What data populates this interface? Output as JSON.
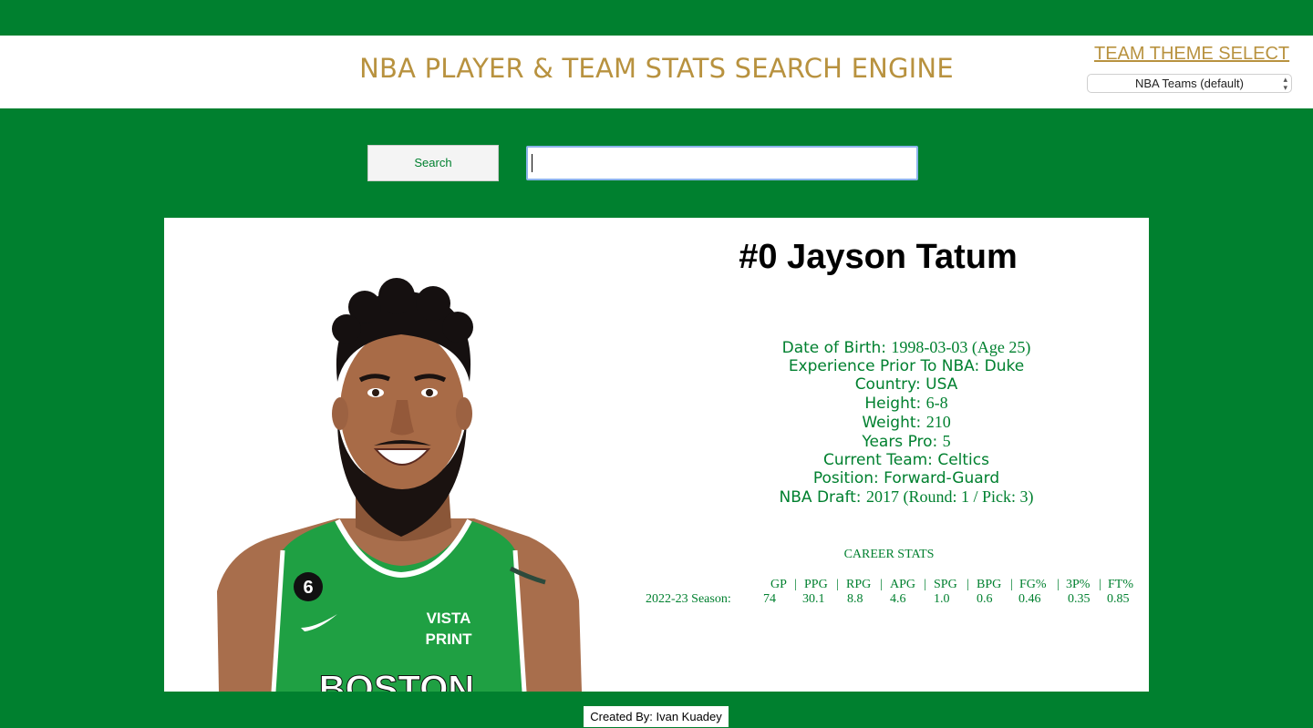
{
  "header": {
    "title": "NBA PLAYER & TEAM STATS SEARCH ENGINE",
    "theme_link": "TEAM THEME SELECT",
    "theme_selected": "NBA Teams (default)"
  },
  "search": {
    "button_label": "Search",
    "value": ""
  },
  "player": {
    "name": "#0 Jayson Tatum",
    "bio": [
      {
        "label": "Date of Birth:",
        "value": "1998-03-03 (Age 25)"
      },
      {
        "label": "Experience Prior To NBA:",
        "value": "Duke"
      },
      {
        "label": "Country:",
        "value": "USA"
      },
      {
        "label": "Height:",
        "value": "6-8"
      },
      {
        "label": "Weight:",
        "value": "210"
      },
      {
        "label": "Years Pro:",
        "value": "5"
      },
      {
        "label": "Current Team:",
        "value": "Celtics"
      },
      {
        "label": "Position:",
        "value": "Forward-Guard"
      },
      {
        "label": "NBA Draft:",
        "value": "2017 (Round: 1 / Pick: 3)"
      }
    ],
    "jersey": {
      "number": "6",
      "sponsor_line1": "VISTA",
      "sponsor_line2": "PRINT",
      "team_text": "BOSTON"
    }
  },
  "career_stats": {
    "title": "CAREER STATS",
    "columns": [
      "GP",
      "PPG",
      "RPG",
      "APG",
      "SPG",
      "BPG",
      "FG%",
      "3P%",
      "FT%"
    ],
    "row_label": "2022-23 Season:",
    "values": [
      "74",
      "30.1",
      "8.8",
      "4.6",
      "1.0",
      "0.6",
      "0.46",
      "0.35",
      "0.85"
    ]
  },
  "footer": {
    "credit": "Created By: Ivan Kuadey"
  },
  "colors": {
    "background": "#00802f",
    "accent": "#b8923f",
    "text_green": "#00802f"
  }
}
